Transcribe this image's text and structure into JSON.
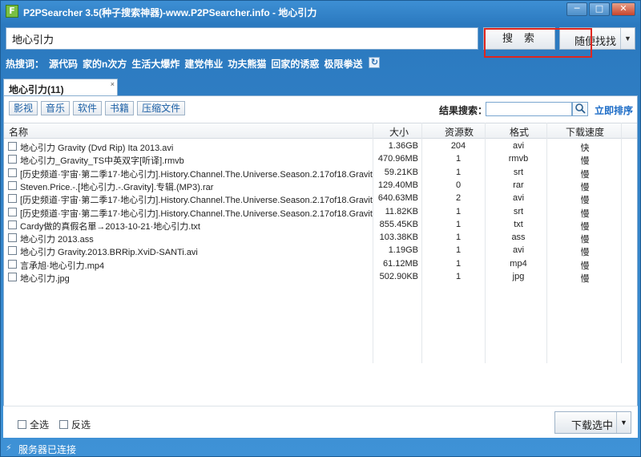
{
  "window": {
    "title": "P2PSearcher 3.5(种子搜索神器)-www.P2PSearcher.info - 地心引力",
    "app_icon_letter": "F",
    "min_glyph": "─",
    "max_glyph": "□",
    "close_glyph": "✕"
  },
  "search": {
    "query": "地心引力",
    "search_button": "搜索",
    "random_button": "随便找找",
    "random_arrow": "▼"
  },
  "hot": {
    "label": "热搜词：",
    "words": [
      "源代码",
      "家的n次方",
      "生活大爆炸",
      "建党伟业",
      "功夫熊猫",
      "回家的诱惑",
      "极限拳送"
    ],
    "refresh_glyph": "↻"
  },
  "tab": {
    "label": "地心引力(11)",
    "close_glyph": "×"
  },
  "filters": [
    "影视",
    "音乐",
    "软件",
    "书籍",
    "压缩文件"
  ],
  "result_search": {
    "label": "结果搜索：",
    "value": "",
    "search_glyph": "🔍",
    "sort_label": "立即排序"
  },
  "table": {
    "headers": {
      "name": "名称",
      "size": "大小",
      "sources": "资源数",
      "format": "格式",
      "speed": "下载速度"
    },
    "rows": [
      {
        "name": "地心引力 Gravity (Dvd Rip) Ita 2013.avi",
        "size": "1.36GB",
        "sources": "204",
        "format": "avi",
        "speed": "快"
      },
      {
        "name": "地心引力_Gravity_TS中英双字[听译].rmvb",
        "size": "470.96MB",
        "sources": "1",
        "format": "rmvb",
        "speed": "慢"
      },
      {
        "name": "[历史频道·宇宙·第二季17·地心引力].History.Channel.The.Universe.Season.2.17of18.Gravit...",
        "size": "59.21KB",
        "sources": "1",
        "format": "srt",
        "speed": "慢"
      },
      {
        "name": "Steven.Price.-.[地心引力.-.Gravity].专辑.(MP3).rar",
        "size": "129.40MB",
        "sources": "0",
        "format": "rar",
        "speed": "慢"
      },
      {
        "name": "[历史频道·宇宙·第二季17·地心引力].History.Channel.The.Universe.Season.2.17of18.Gravit...",
        "size": "640.63MB",
        "sources": "2",
        "format": "avi",
        "speed": "慢"
      },
      {
        "name": "[历史频道·宇宙·第二季17·地心引力].History.Channel.The.Universe.Season.2.17of18.Gravit...",
        "size": "11.82KB",
        "sources": "1",
        "format": "srt",
        "speed": "慢"
      },
      {
        "name": "Cardy做的真假名單→2013-10-21·地心引力.txt",
        "size": "855.45KB",
        "sources": "1",
        "format": "txt",
        "speed": "慢"
      },
      {
        "name": "地心引力  2013.ass",
        "size": "103.38KB",
        "sources": "1",
        "format": "ass",
        "speed": "慢"
      },
      {
        "name": "地心引力 Gravity.2013.BRRip.XviD-SANTi.avi",
        "size": "1.19GB",
        "sources": "1",
        "format": "avi",
        "speed": "慢"
      },
      {
        "name": "言承旭·地心引力.mp4",
        "size": "61.12MB",
        "sources": "1",
        "format": "mp4",
        "speed": "慢"
      },
      {
        "name": "地心引力.jpg",
        "size": "502.90KB",
        "sources": "1",
        "format": "jpg",
        "speed": "慢"
      }
    ]
  },
  "bottom": {
    "select_all": "全选",
    "invert": "反选",
    "download_button": "下载选中",
    "download_arrow": "▼"
  },
  "status": {
    "icon_glyph": "⚡",
    "text": "服务器已连接"
  },
  "colors": {
    "window_blue": "#2f7fc4",
    "highlight_red": "#e0261e",
    "link_blue": "#1b6bc6"
  }
}
